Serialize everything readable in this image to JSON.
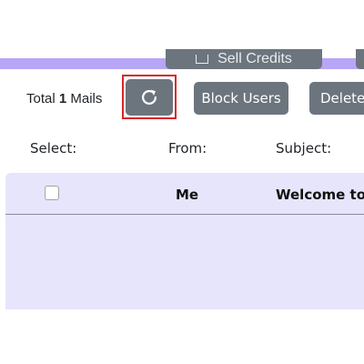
{
  "toolbar_top": {
    "sell_credits_label": "Sell Credits"
  },
  "mail_summary": {
    "prefix": "Total",
    "count": "1",
    "suffix": "Mails"
  },
  "actions": {
    "refresh_icon": "refresh-icon",
    "block_users_label": "Block Users",
    "delete_label": "Delete"
  },
  "filters": {
    "select_label": "Select:",
    "from_label": "From:",
    "subject_label": "Subject:"
  },
  "mails": [
    {
      "from": "Me",
      "subject": "Welcome to H",
      "checked": false
    }
  ],
  "colors": {
    "accent_band": "#b7a6f5",
    "button_grey": "#6c757d",
    "table_bg": "#e7e5fb",
    "highlight": "#d9232b"
  }
}
